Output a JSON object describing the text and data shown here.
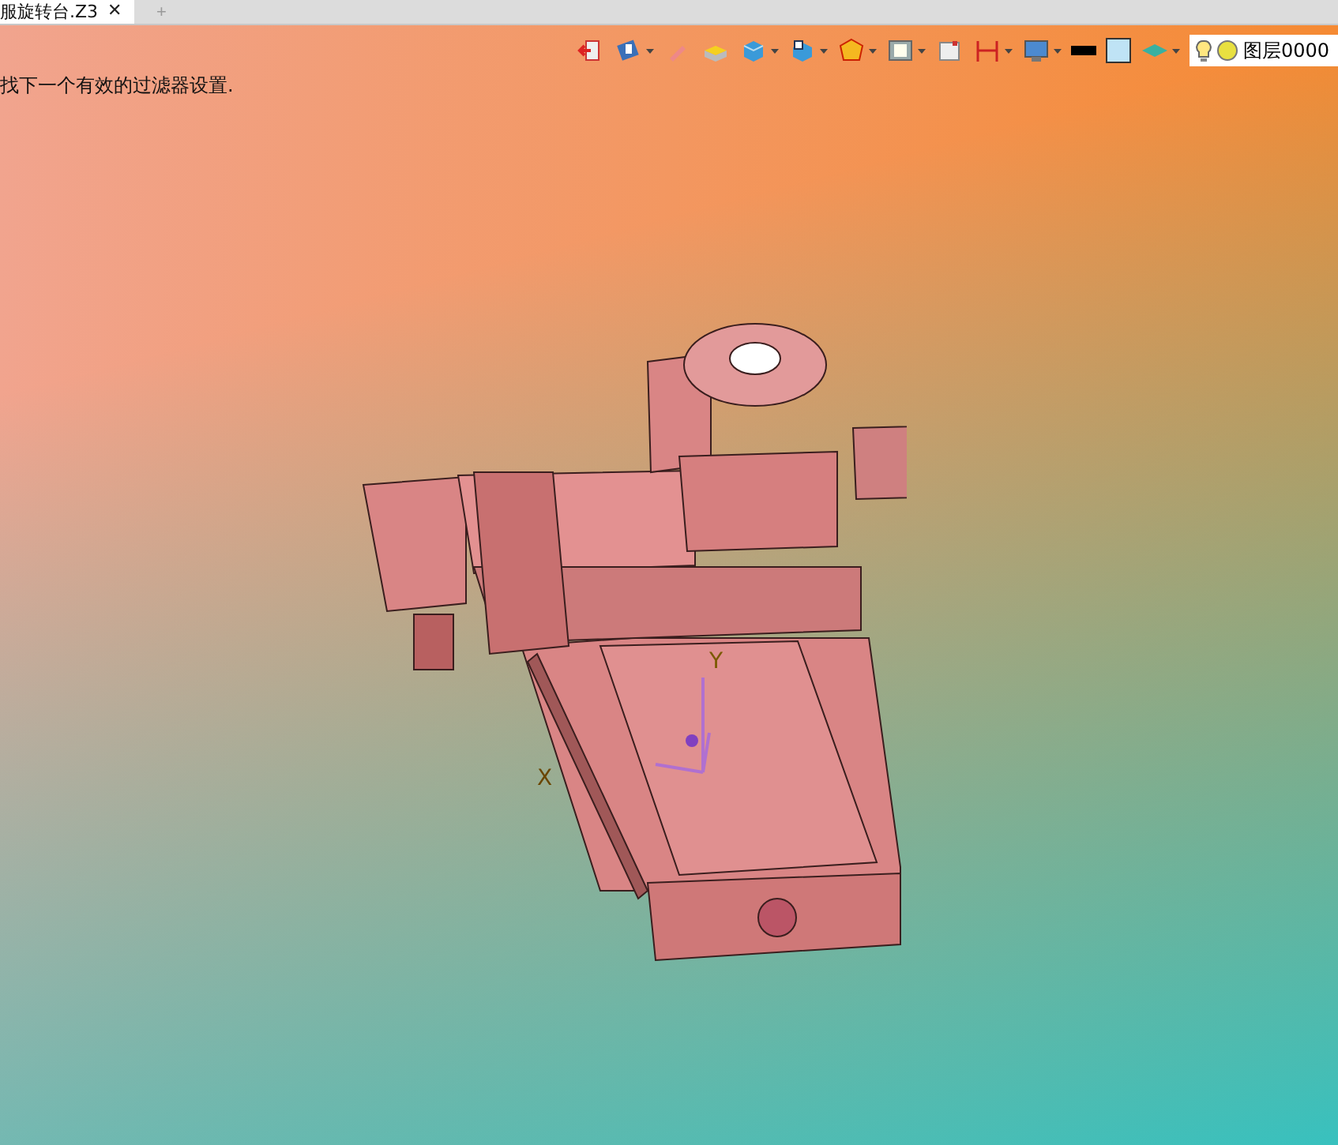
{
  "tab": {
    "title": "服旋转台.Z3",
    "close": "✕",
    "new_tab": "+"
  },
  "message": "找下一个有效的过滤器设置.",
  "layer": {
    "name": "图层0000"
  },
  "axis_labels": [
    "Y",
    "X"
  ]
}
